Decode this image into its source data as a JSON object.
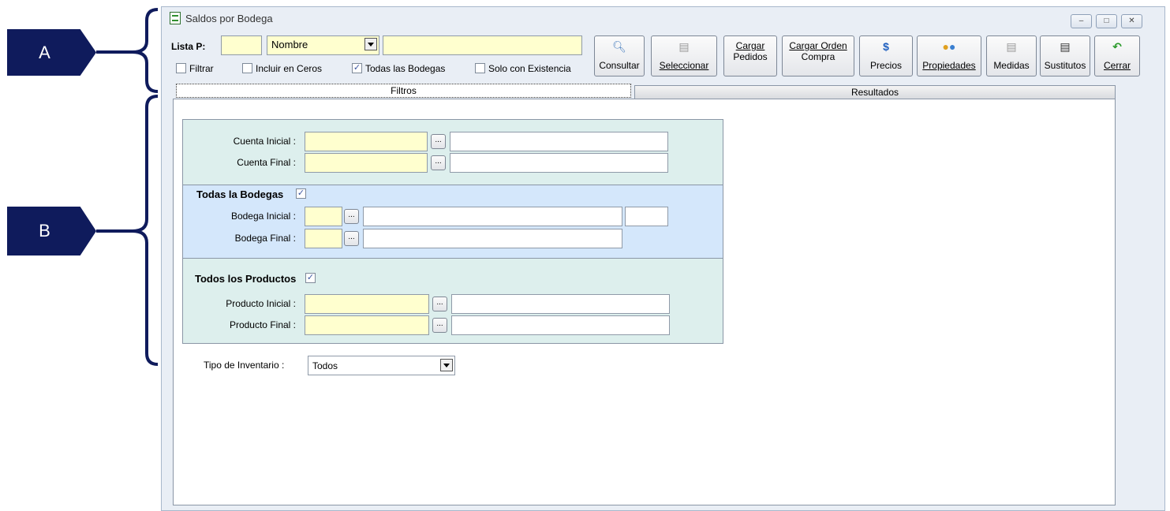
{
  "annotations": {
    "a": "A",
    "b": "B"
  },
  "window": {
    "title": "Saldos por Bodega"
  },
  "toolbar": {
    "lista_label": "Lista P:",
    "lista_code": "",
    "lista_select": "Nombre",
    "lista_name": "",
    "checks": [
      {
        "label": "Filtrar",
        "checked": false
      },
      {
        "label": "Incluir en Ceros",
        "checked": false
      },
      {
        "label": "Todas las Bodegas",
        "checked": true
      },
      {
        "label": "Solo con Existencia",
        "checked": false
      }
    ],
    "buttons": {
      "consultar": "Consultar",
      "seleccionar": "Seleccionar",
      "cargar_pedidos_1": "Cargar",
      "cargar_pedidos_2": "Pedidos",
      "cargar_orden_1": "Cargar Orden",
      "cargar_orden_2": "Compra",
      "precios": "Precios",
      "propiedades": "Propiedades",
      "medidas": "Medidas",
      "sustitutos": "Sustitutos",
      "cerrar": "Cerrar"
    }
  },
  "tabs": {
    "filtros": "Filtros",
    "resultados": "Resultados"
  },
  "filters": {
    "cuenta_inicial": "Cuenta Inicial :",
    "cuenta_final": "Cuenta Final :",
    "todas_bodegas": "Todas la Bodegas",
    "bodega_inicial": "Bodega Inicial :",
    "bodega_final": "Bodega Final :",
    "todos_productos": "Todos los Productos",
    "producto_inicial": "Producto Inicial :",
    "producto_final": "Producto Final :",
    "tipo_inventario": "Tipo de Inventario :",
    "tipo_inventario_value": "Todos",
    "ellipsis": "..."
  },
  "colors": {
    "section_green": "#ddefed",
    "section_blue": "#d4e7fb",
    "field_yellow": "#ffffcf",
    "marker_navy": "#0f1b5c"
  }
}
